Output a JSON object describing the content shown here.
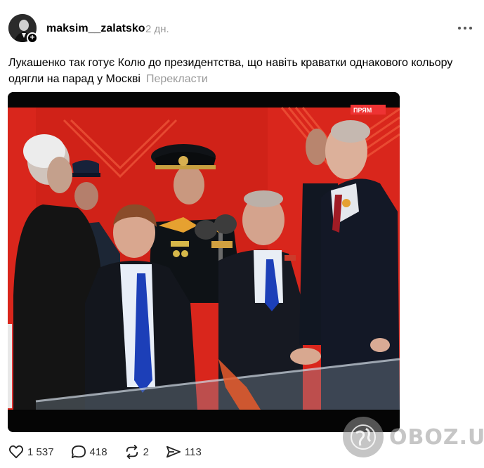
{
  "post": {
    "author": {
      "username": "maksim__zalatsko",
      "avatar_icon": "profile-photo",
      "follow_icon": "plus-icon"
    },
    "timestamp": "2 дн.",
    "more_icon": "more-horizontal-icon",
    "text": "Лукашенко так готує Колю до президентства, що навіть краватки однакового кольору одягли на парад у Москві",
    "translate_label": "Перекласти",
    "image": {
      "background_accent": "#d9261c",
      "tie_color": "#1c3fb8"
    }
  },
  "actions": {
    "like": {
      "icon": "heart-icon",
      "count": "1 537"
    },
    "comment": {
      "icon": "comment-icon",
      "count": "418"
    },
    "repost": {
      "icon": "repost-icon",
      "count": "2"
    },
    "share": {
      "icon": "send-icon",
      "count": "113"
    }
  },
  "watermark": {
    "text": "OBOZ.UA",
    "icon": "globe-icon"
  }
}
